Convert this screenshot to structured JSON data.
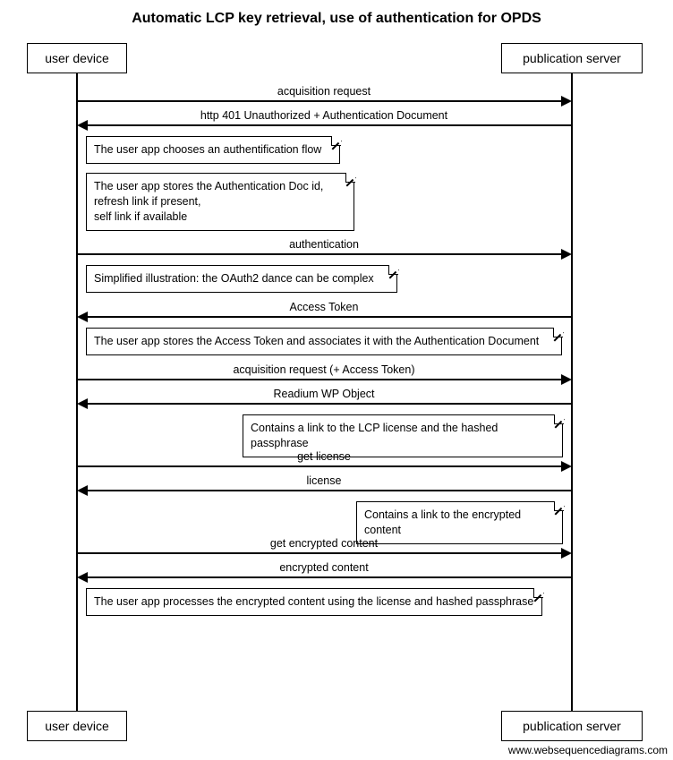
{
  "title": "Automatic LCP key retrieval, use of authentication for OPDS",
  "actors": {
    "left": "user device",
    "right": "publication server"
  },
  "messages": {
    "m1": "acquisition request",
    "m2": "http 401 Unauthorized + Authentication Document",
    "m3": "authentication",
    "m4": "Access Token",
    "m5": "acquisition request (+ Access Token)",
    "m6": "Readium WP Object",
    "m7": "get license",
    "m8": "license",
    "m9": "get encrypted content",
    "m10": "encrypted content"
  },
  "notes": {
    "n1": "The user app chooses an authentification flow",
    "n2a": "The user app stores the Authentication Doc id,",
    "n2b": "refresh link if present,",
    "n2c": "self link if available",
    "n3": "Simplified illustration: the OAuth2 dance can be complex",
    "n4": "The user app stores the Access Token and associates it with the Authentication Document",
    "n5": "Contains a link to the LCP license and the hashed passphrase",
    "n6": "Contains a link to the encrypted content",
    "n7": "The user app processes the encrypted content using the license and hashed passphrase"
  },
  "watermark": "www.websequencediagrams.com",
  "chart_data": {
    "type": "sequence-diagram",
    "title": "Automatic LCP key retrieval, use of authentication for OPDS",
    "participants": [
      "user device",
      "publication server"
    ],
    "events": [
      {
        "kind": "message",
        "from": "user device",
        "to": "publication server",
        "text": "acquisition request"
      },
      {
        "kind": "message",
        "from": "publication server",
        "to": "user device",
        "text": "http 401 Unauthorized + Authentication Document"
      },
      {
        "kind": "note",
        "over": "user device",
        "text": "The user app chooses an authentification flow"
      },
      {
        "kind": "note",
        "over": "user device",
        "text": "The user app stores the Authentication Doc id, refresh link if present, self link if available"
      },
      {
        "kind": "message",
        "from": "user device",
        "to": "publication server",
        "text": "authentication"
      },
      {
        "kind": "note",
        "over": "user device",
        "text": "Simplified illustration: the OAuth2 dance can be complex"
      },
      {
        "kind": "message",
        "from": "publication server",
        "to": "user device",
        "text": "Access Token"
      },
      {
        "kind": "note",
        "over": "user device",
        "text": "The user app stores the Access Token and associates it with the Authentication Document"
      },
      {
        "kind": "message",
        "from": "user device",
        "to": "publication server",
        "text": "acquisition request (+ Access Token)"
      },
      {
        "kind": "message",
        "from": "publication server",
        "to": "user device",
        "text": "Readium WP Object"
      },
      {
        "kind": "note",
        "over": "publication server",
        "text": "Contains a link to the LCP license and the hashed passphrase"
      },
      {
        "kind": "message",
        "from": "user device",
        "to": "publication server",
        "text": "get license"
      },
      {
        "kind": "message",
        "from": "publication server",
        "to": "user device",
        "text": "license"
      },
      {
        "kind": "note",
        "over": "publication server",
        "text": "Contains a link to the encrypted content"
      },
      {
        "kind": "message",
        "from": "user device",
        "to": "publication server",
        "text": "get encrypted content"
      },
      {
        "kind": "message",
        "from": "publication server",
        "to": "user device",
        "text": "encrypted content"
      },
      {
        "kind": "note",
        "over": "user device",
        "text": "The user app processes the encrypted content using the license and hashed passphrase"
      }
    ]
  }
}
